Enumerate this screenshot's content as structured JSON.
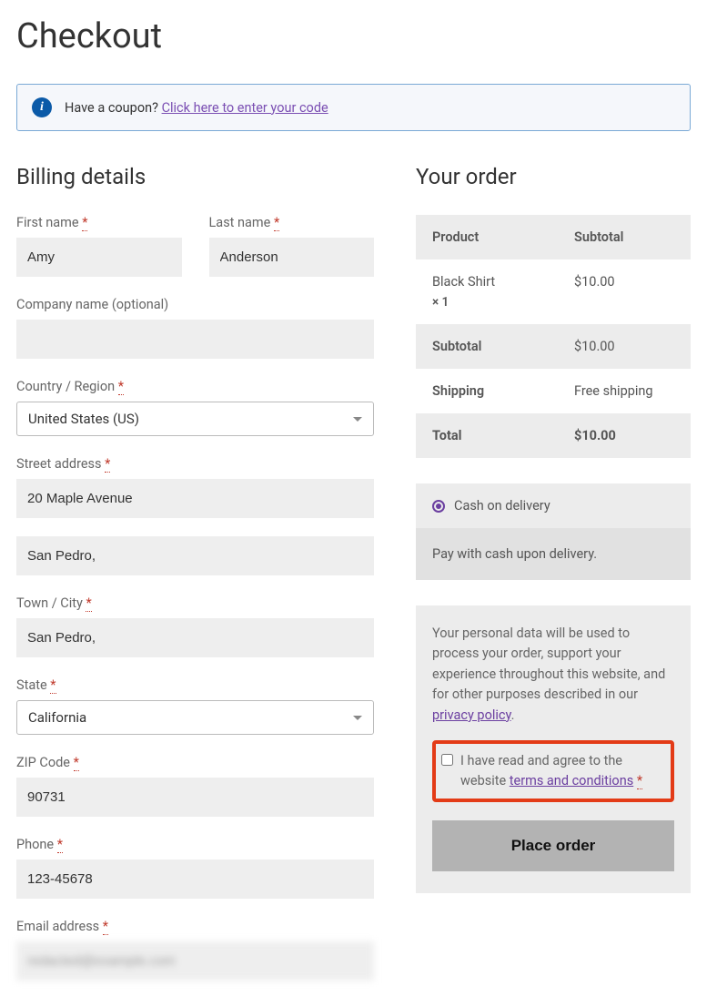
{
  "page_title": "Checkout",
  "coupon": {
    "prompt": "Have a coupon?",
    "link": "Click here to enter your code"
  },
  "billing": {
    "heading": "Billing details",
    "first_name_label": "First name",
    "first_name_value": "Amy",
    "last_name_label": "Last name",
    "last_name_value": "Anderson",
    "company_label": "Company name (optional)",
    "company_value": "",
    "country_label": "Country / Region",
    "country_value": "United States (US)",
    "street_label": "Street address",
    "street_value": "20 Maple Avenue",
    "street2_value": "San Pedro,",
    "city_label": "Town / City",
    "city_value": "San Pedro,",
    "state_label": "State",
    "state_value": "California",
    "zip_label": "ZIP Code",
    "zip_value": "90731",
    "phone_label": "Phone",
    "phone_value": "123-45678",
    "email_label": "Email address",
    "email_value": "redacted@example.com"
  },
  "order": {
    "heading": "Your order",
    "product_col": "Product",
    "subtotal_col": "Subtotal",
    "product_name": "Black Shirt",
    "product_qty": "× 1",
    "product_price": "$10.00",
    "subtotal_label": "Subtotal",
    "subtotal_value": "$10.00",
    "shipping_label": "Shipping",
    "shipping_value": "Free shipping",
    "total_label": "Total",
    "total_value": "$10.00"
  },
  "payment": {
    "method_label": "Cash on delivery",
    "method_desc": "Pay with cash upon delivery."
  },
  "privacy": {
    "text_before": "Your personal data will be used to process your order, support your experience throughout this website, and for other purposes described in our ",
    "link": "privacy policy",
    "text_after": "."
  },
  "terms": {
    "text_before": "I have read and agree to the website ",
    "link": "terms and conditions"
  },
  "place_order_label": "Place order",
  "required_mark": "*"
}
